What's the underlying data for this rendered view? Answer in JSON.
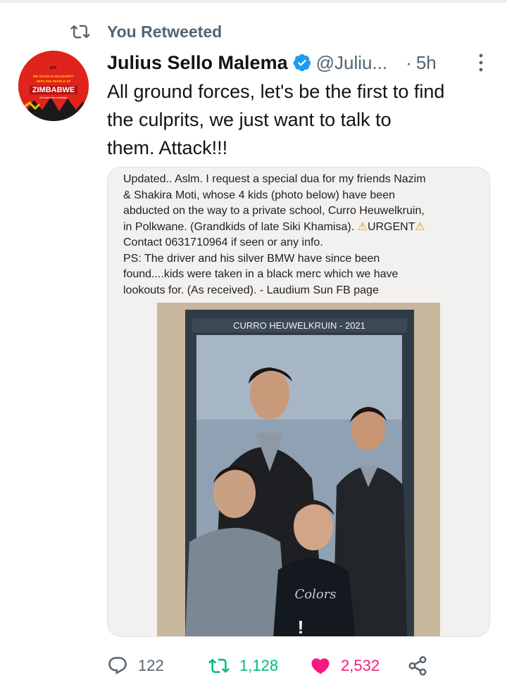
{
  "retweet_banner": {
    "label": "You Retweeted"
  },
  "author": {
    "name": "Julius Sello Malema",
    "handle": "@Juliu...",
    "time": "5h",
    "avatar_text": [
      "EFF",
      "WE STAND IN SOLIDARITY",
      "WITH THE PEOPLE OF",
      "ZIMBABWE",
      "#ZimbabweanLivesMatter"
    ]
  },
  "tweet": {
    "text_lines": [
      "All ground forces, let's be the first to find",
      "the culprits, we just want to talk to",
      "them. Attack!!!"
    ]
  },
  "media": {
    "caption_lines": [
      "Updated.. Aslm. I request a special dua for my friends Nazim",
      "& Shakira Moti, whose 4 kids (photo below) have been",
      "abducted on the way to a private school, Curro Heuwelkruin,",
      "in Polkwane. (Grandkids of late Siki Khamisa).",
      "URGENT",
      "Contact 0631710964 if seen or any info.",
      "PS: The driver and his silver BMW have since been",
      "found....kids were taken in a black merc which we have",
      "lookouts for. (As received). - Laudium Sun FB page"
    ],
    "warning_glyph": "⚠",
    "photo_header": "CURRO HEUWELKRUIN - 2021",
    "shirt_text": "Colors",
    "photo_mark": "!"
  },
  "actions": {
    "reply_count": "122",
    "retweet_count": "1,128",
    "like_count": "2,532"
  },
  "colors": {
    "retweet_green": "#00ba7c",
    "like_pink": "#f91880",
    "muted_gray": "#536471",
    "verified_blue": "#1d9bf0"
  }
}
